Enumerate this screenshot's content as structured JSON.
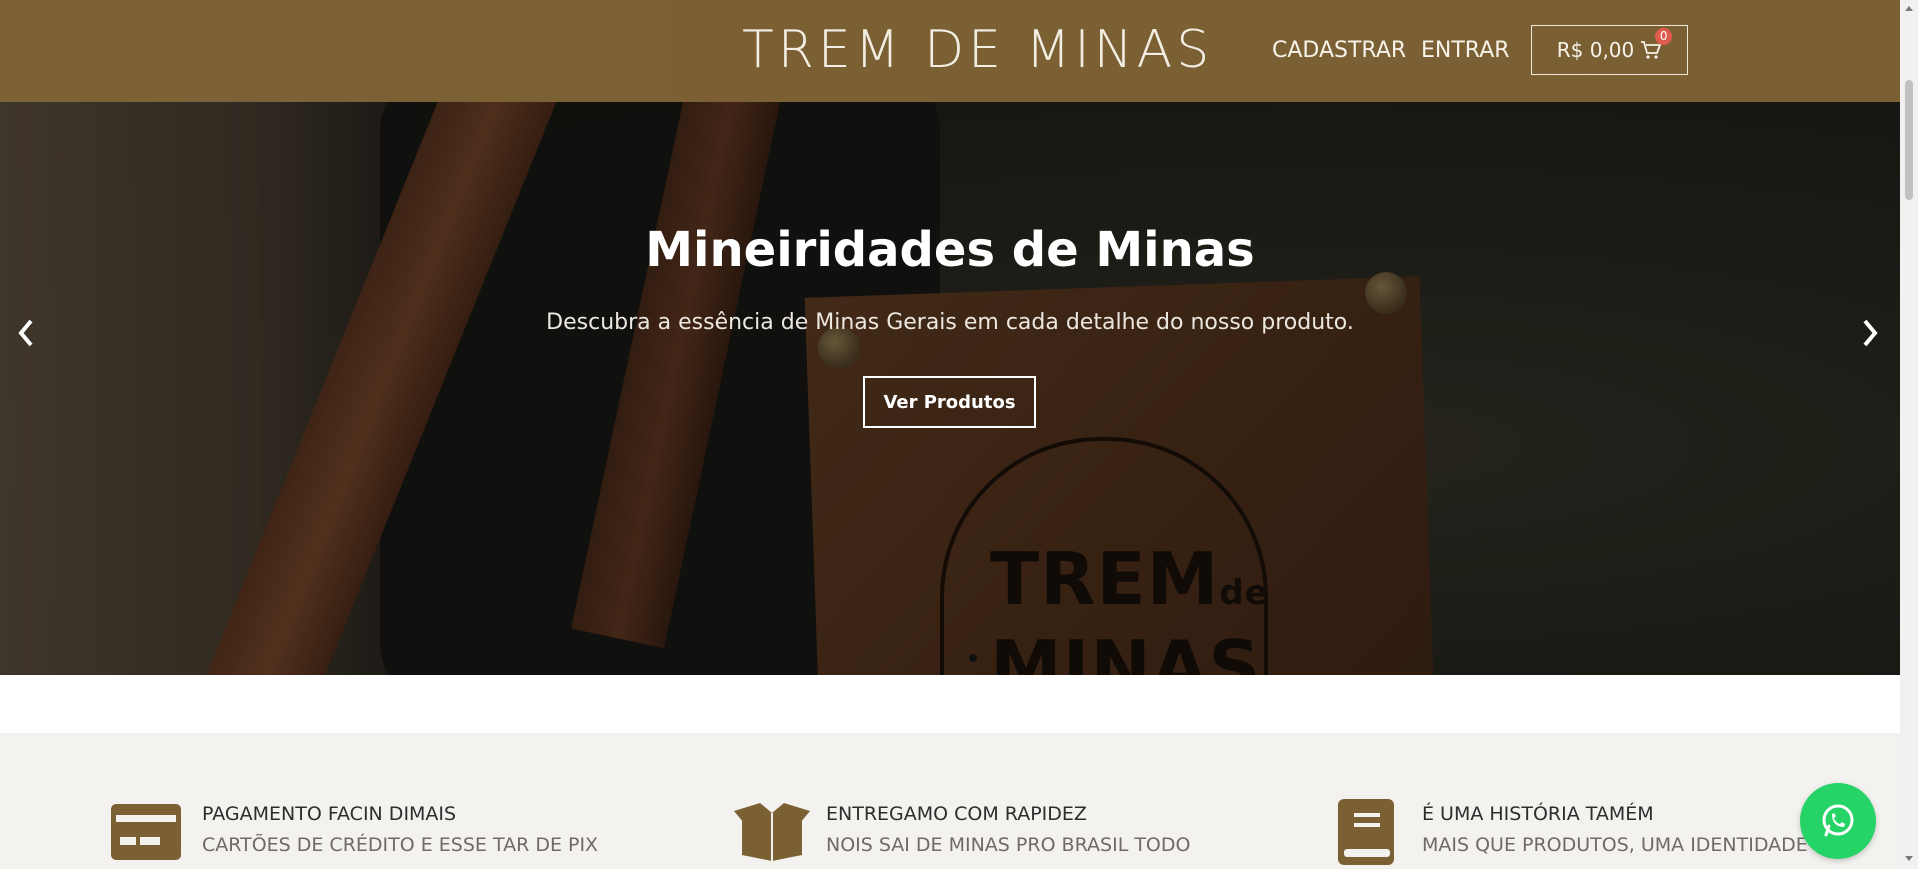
{
  "header": {
    "brand": "TREM DE MINAS",
    "nav": {
      "register": "CADASTRAR",
      "login": "ENTRAR"
    },
    "cart": {
      "total": "R$ 0,00",
      "count": "0"
    }
  },
  "hero": {
    "title": "Mineiridades de Minas",
    "subtitle": "Descubra a essência de Minas Gerais em cada detalhe do nosso produto.",
    "button": "Ver Produtos",
    "patch_logo": {
      "line1": "TREM",
      "de": "de",
      "line2": "MINAS"
    },
    "slide_index": 1,
    "slide_count": 1
  },
  "features": [
    {
      "icon": "credit-card-icon",
      "title": "PAGAMENTO FACIN DIMAIS",
      "subtitle": "CARTÕES DE CRÉDITO E ESSE TAR DE PIX"
    },
    {
      "icon": "box-open-icon",
      "title": "ENTREGAMO COM RAPIDEZ",
      "subtitle": "NOIS SAI DE MINAS PRO BRASIL TODO"
    },
    {
      "icon": "book-icon",
      "title": "É UMA HISTÓRIA TAMÉM",
      "subtitle": "MAIS QUE PRODUTOS, UMA IDENTIDADE"
    }
  ],
  "colors": {
    "brand": "#7b6034",
    "whatsapp": "#25d366",
    "badge": "#e05a4e",
    "feature_bg": "#f3f2ef"
  }
}
